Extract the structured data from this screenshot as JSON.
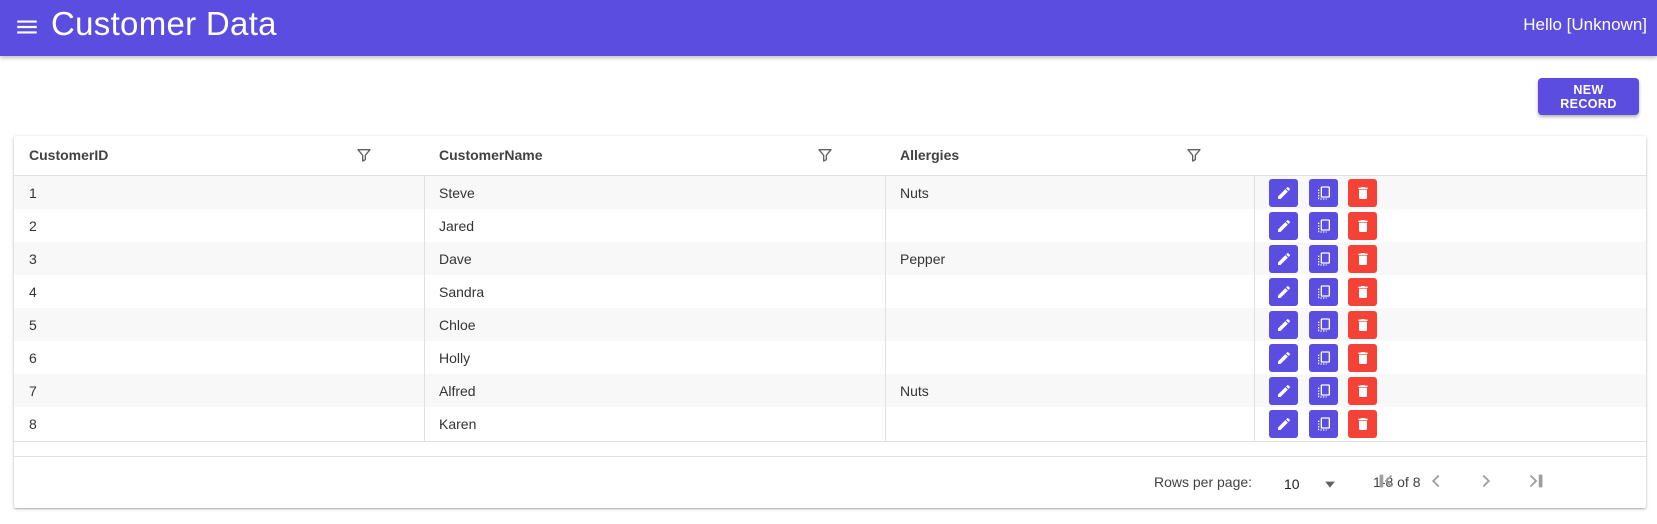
{
  "app": {
    "title": "Customer Data",
    "greeting": "Hello [Unknown]",
    "accent_color": "#5a4ddf",
    "delete_color": "#f44336"
  },
  "toolbar": {
    "new_record_label": "NEW RECORD"
  },
  "table": {
    "columns": [
      {
        "label": "CustomerID",
        "icon": "filter-icon"
      },
      {
        "label": "CustomerName",
        "icon": "filter-icon"
      },
      {
        "label": "Allergies",
        "icon": "filter-icon"
      }
    ],
    "rows": [
      {
        "id": "1",
        "name": "Steve",
        "allergies": "Nuts"
      },
      {
        "id": "2",
        "name": "Jared",
        "allergies": ""
      },
      {
        "id": "3",
        "name": "Dave",
        "allergies": "Pepper"
      },
      {
        "id": "4",
        "name": "Sandra",
        "allergies": ""
      },
      {
        "id": "5",
        "name": "Chloe",
        "allergies": ""
      },
      {
        "id": "6",
        "name": "Holly",
        "allergies": ""
      },
      {
        "id": "7",
        "name": "Alfred",
        "allergies": "Nuts"
      },
      {
        "id": "8",
        "name": "Karen",
        "allergies": ""
      }
    ],
    "row_actions": [
      "edit-icon",
      "copy-icon",
      "delete-icon"
    ]
  },
  "pager": {
    "rows_per_page_label": "Rows per page:",
    "rows_per_page_value": "10",
    "range_text": "1-8 of 8",
    "nav_icons": [
      "first-page-icon",
      "previous-page-icon",
      "next-page-icon",
      "last-page-icon"
    ]
  }
}
